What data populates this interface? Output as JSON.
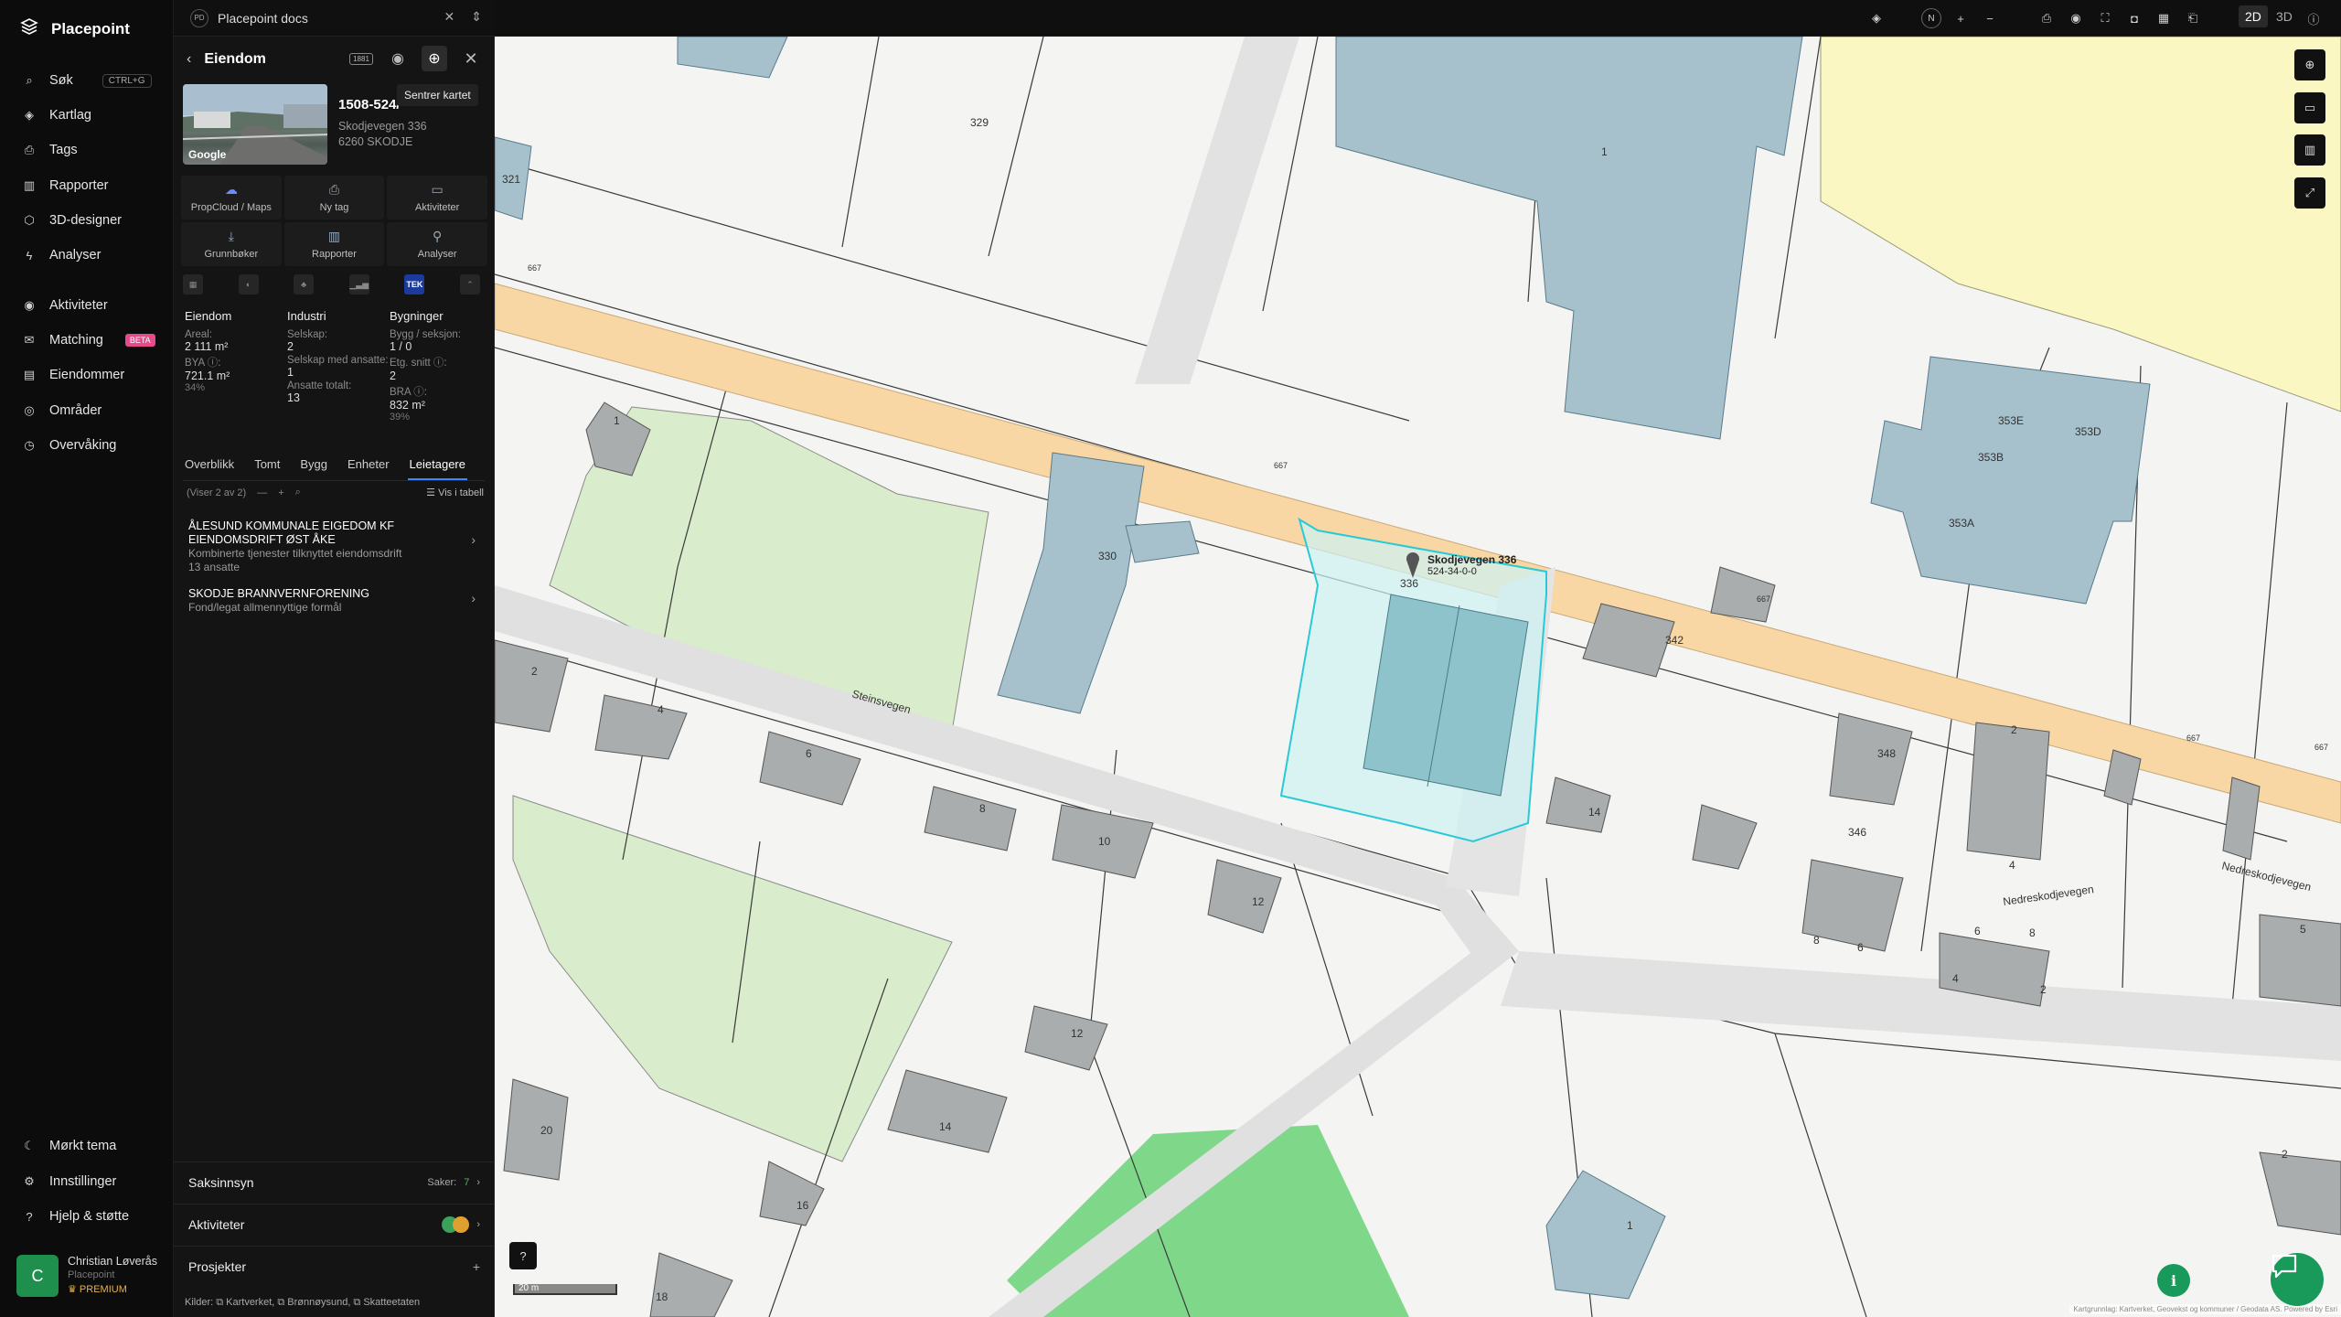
{
  "nav": {
    "brand": "Placepoint",
    "items": [
      {
        "label": "Søk",
        "shortcut": "CTRL+G",
        "icon": "search-icon"
      },
      {
        "label": "Kartlag",
        "icon": "layers-icon"
      },
      {
        "label": "Tags",
        "icon": "bookmark-icon"
      },
      {
        "label": "Rapporter",
        "icon": "chart-icon"
      },
      {
        "label": "3D-designer",
        "icon": "cube-icon"
      },
      {
        "label": "Analyser",
        "icon": "bolt-icon"
      },
      {
        "label": "Aktiviteter",
        "icon": "activity-icon"
      },
      {
        "label": "Matching",
        "badge": "BETA",
        "icon": "matching-icon"
      },
      {
        "label": "Eiendommer",
        "icon": "document-icon"
      },
      {
        "label": "Områder",
        "icon": "area-icon"
      },
      {
        "label": "Overvåking",
        "icon": "monitor-icon"
      }
    ],
    "bottom": [
      {
        "label": "Mørkt tema",
        "icon": "moon-icon"
      },
      {
        "label": "Innstillinger",
        "icon": "gear-icon"
      },
      {
        "label": "Hjelp & støtte",
        "icon": "help-icon"
      }
    ],
    "user": {
      "initial": "C",
      "name": "Christian Løverås",
      "org": "Placepoint",
      "plan": "PREMIUM"
    }
  },
  "panel": {
    "tab_logo": "PD",
    "tab_title": "Placepoint docs",
    "header_title": "Eiendom",
    "header_badge": "1881",
    "tooltip": "Sentrer kartet",
    "property_id": "1508-524/",
    "address_line1": "Skodjevegen 336",
    "address_line2": "6260 SKODJE",
    "photo_credit": "Google",
    "actions": [
      {
        "label": "PropCloud / Maps",
        "icon": "cloud-icon"
      },
      {
        "label": "Ny tag",
        "icon": "tag-icon"
      },
      {
        "label": "Aktiviteter",
        "icon": "activity-icon"
      },
      {
        "label": "Grunnbøker",
        "icon": "download-icon"
      },
      {
        "label": "Rapporter",
        "icon": "chart-icon"
      },
      {
        "label": "Analyser",
        "icon": "pin-icon"
      }
    ],
    "layer_tek": "TEK",
    "facts": {
      "eiendom": {
        "title": "Eiendom",
        "areal_label": "Areal:",
        "areal_value": "2 111 m²",
        "bya_label": "BYA ⓘ:",
        "bya_value": "721.1 m²",
        "bya_pct": "34%"
      },
      "industri": {
        "title": "Industri",
        "selskap_label": "Selskap:",
        "selskap_value": "2",
        "ansatte_label": "Selskap med ansatte:",
        "ansatte_value": "1",
        "totalt_label": "Ansatte totalt:",
        "totalt_value": "13"
      },
      "bygninger": {
        "title": "Bygninger",
        "bygg_label": "Bygg / seksjon:",
        "bygg_value": "1 / 0",
        "etg_label": "Etg. snitt ⓘ:",
        "etg_value": "2",
        "bra_label": "BRA ⓘ:",
        "bra_value": "832 m²",
        "bra_pct": "39%"
      }
    },
    "subtabs": [
      "Overblikk",
      "Tomt",
      "Bygg",
      "Enheter",
      "Leietagere"
    ],
    "active_subtab": "Leietagere",
    "list_count": "(Viser 2 av 2)",
    "vis_i_tabell": "Vis i tabell",
    "tenants": [
      {
        "name": "ÅLESUND KOMMUNALE EIGEDOM KF EIENDOMSDRIFT ØST ÅKE",
        "desc": "Kombinerte tjenester tilknyttet eiendomsdrift",
        "employees": "13 ansatte"
      },
      {
        "name": "SKODJE BRANNVERNFORENING",
        "desc": "Fond/legat allmennyttige formål",
        "employees": ""
      }
    ],
    "saksinnsyn": {
      "label": "Saksinnsyn",
      "count_label": "Saker:",
      "count": "7"
    },
    "aktiviteter_label": "Aktiviteter",
    "prosjekter_label": "Prosjekter",
    "sources": "Kilder: ⧉ Kartverket, ⧉ Brønnøysund, ⧉ Skatteetaten"
  },
  "topbar": {
    "compass": "N",
    "mode_2d": "2D",
    "mode_3d": "3D",
    "active_mode": "2D"
  },
  "map": {
    "scale_label": "20 m",
    "attribution": "Kartgrunnlag: Kartverket, Geovekst og kommuner / Geodata AS. Powered by Esri",
    "selected_label": "Skodjevegen 336",
    "selected_sub": "524-34-0-0",
    "labels": [
      "321",
      "329",
      "1",
      "1",
      "2",
      "4",
      "6",
      "8",
      "10",
      "12",
      "12",
      "14",
      "16",
      "18",
      "20",
      "330",
      "336",
      "342",
      "348",
      "346",
      "14",
      "353E",
      "353D",
      "353B",
      "353A",
      "2",
      "4",
      "8",
      "6",
      "6",
      "8",
      "4",
      "2",
      "5",
      "2",
      "1",
      "Nedreskodjevegen",
      "Nedreskodjevegen",
      "Steinsvegen",
      "667",
      "667",
      "667",
      "667",
      "667"
    ],
    "colors": {
      "road": "#f8d7a4",
      "building": "#a6c1cc",
      "house": "#a9adad",
      "green": "#d9eccb",
      "yellow": "#fbf7c2",
      "selection": "#29c9d6"
    }
  }
}
